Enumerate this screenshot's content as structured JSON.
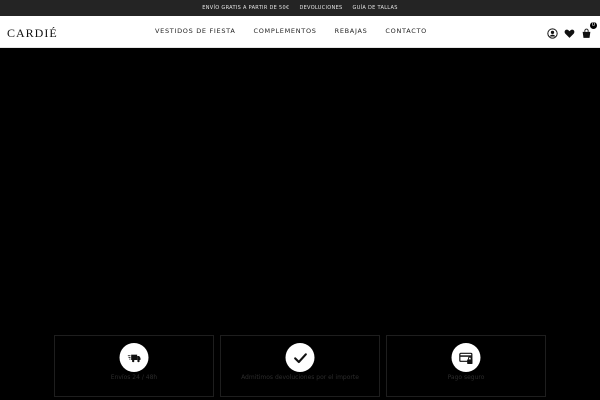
{
  "topbar": {
    "links": [
      "Envío gratis a partir de 50€",
      "Devoluciones",
      "Guía de tallas"
    ]
  },
  "header": {
    "logo": "CARDIÉ",
    "nav": [
      "VESTIDOS DE FIESTA",
      "COMPLEMENTOS",
      "REBAJAS",
      "CONTACTO"
    ],
    "cart_count": "0",
    "icons": [
      "user-icon",
      "heart-icon",
      "cart-icon"
    ]
  },
  "features": [
    {
      "icon": "delivery-truck-icon",
      "text": "Envíos 24 / 48h"
    },
    {
      "icon": "check-icon",
      "text": "Admitimos devoluciones por el importe"
    },
    {
      "icon": "secure-payment-icon",
      "text": "Pago seguro"
    }
  ]
}
